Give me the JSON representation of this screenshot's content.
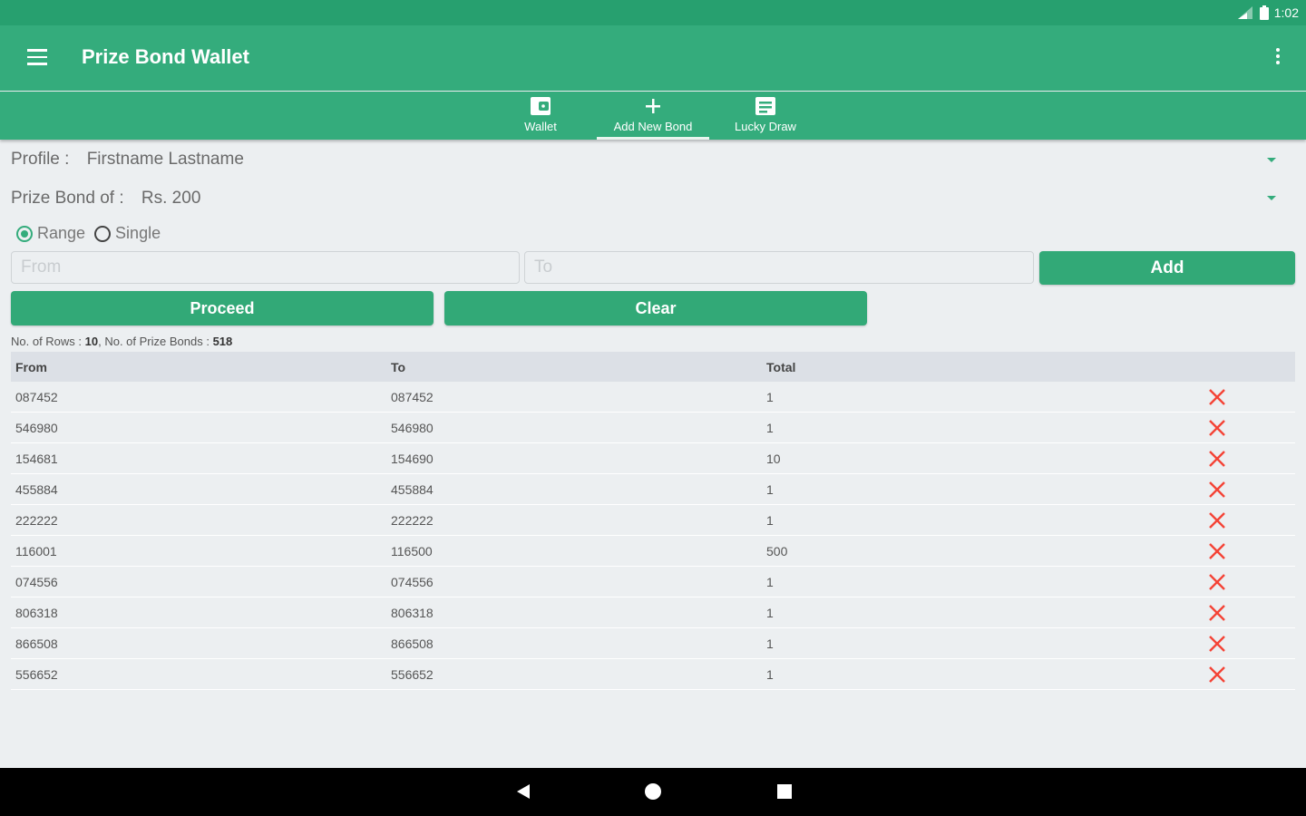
{
  "status_bar": {
    "time": "1:02",
    "icons": [
      "signal-icon",
      "battery-icon"
    ]
  },
  "app_bar": {
    "title": "Prize Bond Wallet"
  },
  "tabs": [
    {
      "label": "Wallet",
      "icon": "wallet-icon",
      "active": false
    },
    {
      "label": "Add New Bond",
      "icon": "plus-icon",
      "active": true
    },
    {
      "label": "Lucky Draw",
      "icon": "list-icon",
      "active": false
    }
  ],
  "form": {
    "profile_label": "Profile :",
    "profile_value": "Firstname Lastname",
    "bond_label": "Prize Bond of :",
    "bond_value": "Rs. 200",
    "radio_range": "Range",
    "radio_single": "Single",
    "selected_mode": "Range",
    "from_placeholder": "From",
    "to_placeholder": "To",
    "add_button": "Add",
    "proceed_button": "Proceed",
    "clear_button": "Clear"
  },
  "summary": {
    "rows_label": "No. of Rows : ",
    "rows_value": "10",
    "bonds_label": ", No. of Prize Bonds : ",
    "bonds_value": "518"
  },
  "table": {
    "headers": {
      "from": "From",
      "to": "To",
      "total": "Total"
    },
    "rows": [
      {
        "from": "087452",
        "to": "087452",
        "total": "1"
      },
      {
        "from": "546980",
        "to": "546980",
        "total": "1"
      },
      {
        "from": "154681",
        "to": "154690",
        "total": "10"
      },
      {
        "from": "455884",
        "to": "455884",
        "total": "1"
      },
      {
        "from": "222222",
        "to": "222222",
        "total": "1"
      },
      {
        "from": "116001",
        "to": "116500",
        "total": "500"
      },
      {
        "from": "074556",
        "to": "074556",
        "total": "1"
      },
      {
        "from": "806318",
        "to": "806318",
        "total": "1"
      },
      {
        "from": "866508",
        "to": "866508",
        "total": "1"
      },
      {
        "from": "556652",
        "to": "556652",
        "total": "1"
      }
    ]
  },
  "colors": {
    "primary": "#34ac7c",
    "primary_dark": "#27a06f",
    "delete": "#f44336",
    "background": "#eceff1"
  }
}
